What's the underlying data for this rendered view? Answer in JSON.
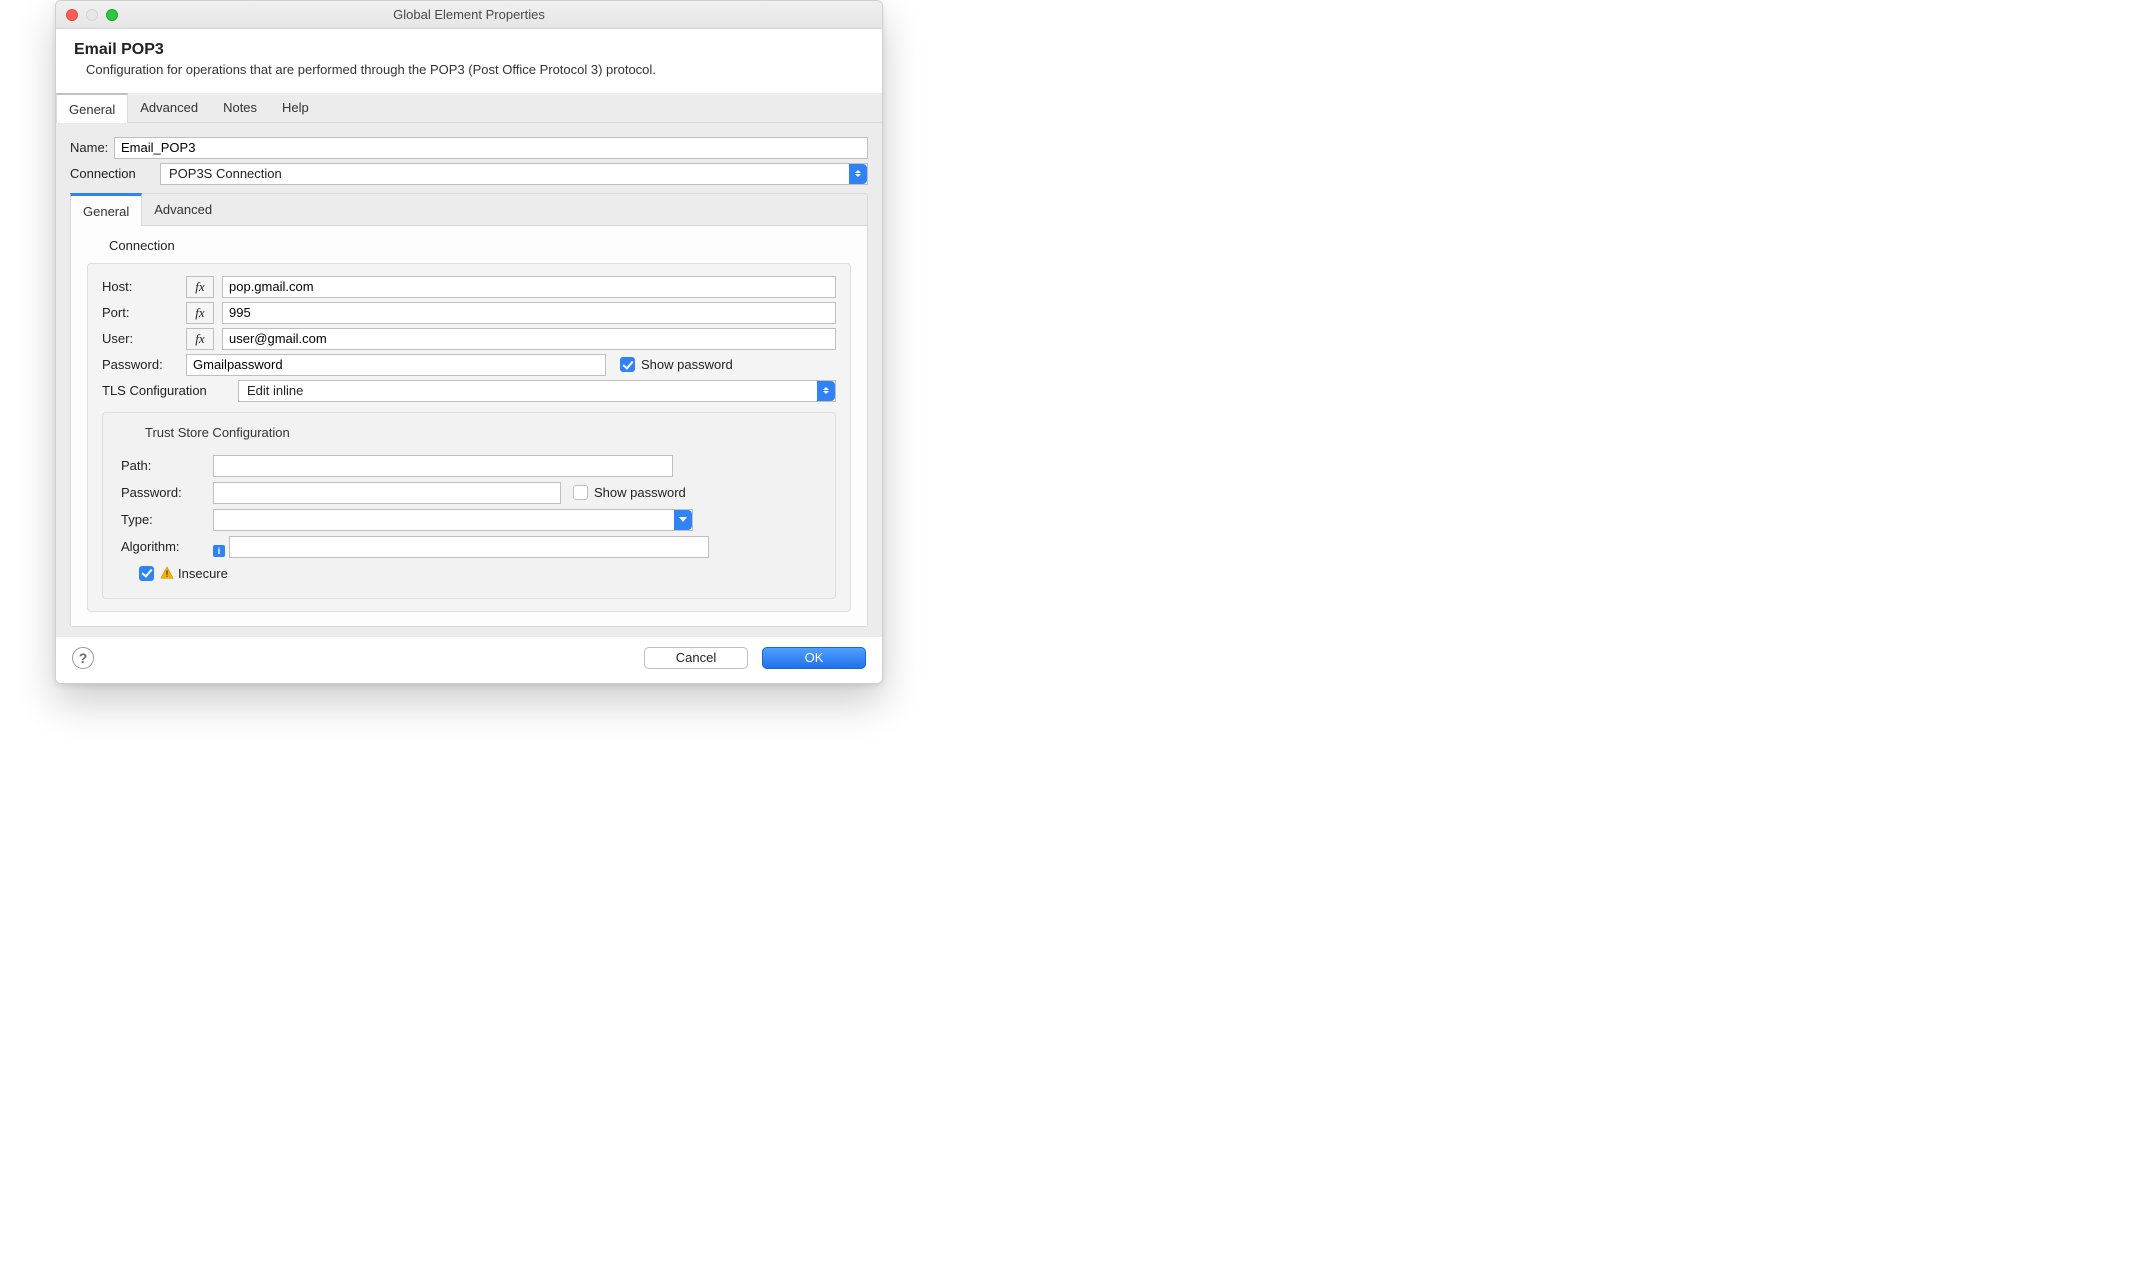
{
  "window": {
    "title": "Global Element Properties"
  },
  "header": {
    "title": "Email POP3",
    "description": "Configuration for operations that are performed through the POP3 (Post Office Protocol 3) protocol."
  },
  "tabs": {
    "items": [
      "General",
      "Advanced",
      "Notes",
      "Help"
    ],
    "active": "General"
  },
  "form": {
    "name_label": "Name:",
    "name_value": "Email_POP3",
    "connection_label": "Connection",
    "connection_value": "POP3S Connection"
  },
  "subtabs": {
    "items": [
      "General",
      "Advanced"
    ],
    "active": "General"
  },
  "connection": {
    "section_label": "Connection",
    "host_label": "Host:",
    "host_value": "pop.gmail.com",
    "port_label": "Port:",
    "port_value": "995",
    "user_label": "User:",
    "user_value": "user@gmail.com",
    "password_label": "Password:",
    "password_value": "Gmailpassword",
    "show_password_label": "Show password",
    "show_password_checked": true,
    "tls_label": "TLS Configuration",
    "tls_value": "Edit inline",
    "fx_label": "fx"
  },
  "trust_store": {
    "title": "Trust Store Configuration",
    "path_label": "Path:",
    "path_value": "",
    "password_label": "Password:",
    "password_value": "",
    "show_password_label": "Show password",
    "show_password_checked": false,
    "type_label": "Type:",
    "type_value": "",
    "algorithm_label": "Algorithm:",
    "algorithm_value": "",
    "insecure_label": "Insecure",
    "insecure_checked": true
  },
  "footer": {
    "cancel": "Cancel",
    "ok": "OK"
  }
}
